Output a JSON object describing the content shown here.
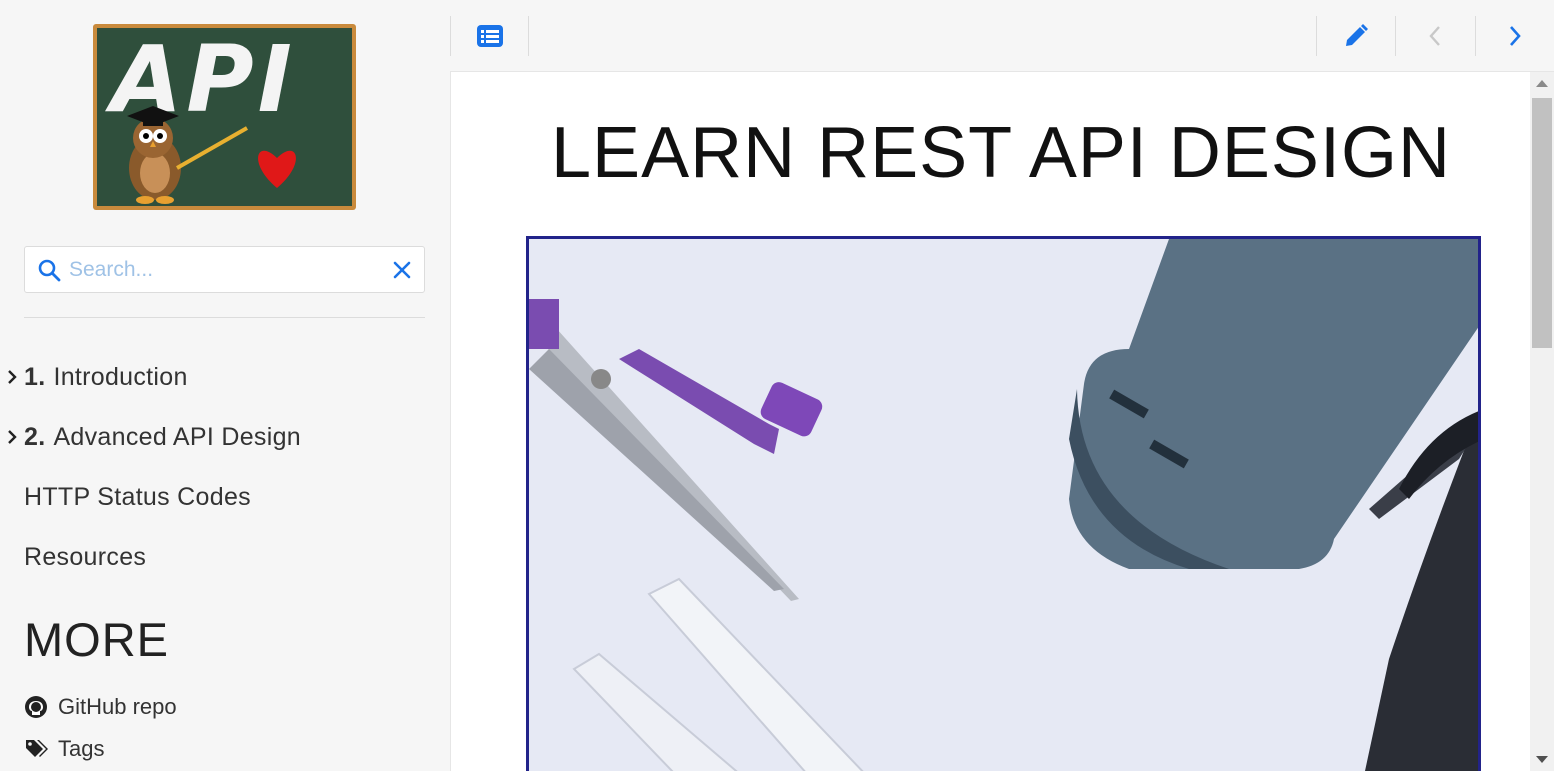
{
  "sidebar": {
    "logo_text": "API",
    "search": {
      "placeholder": "Search...",
      "value": ""
    },
    "nav": [
      {
        "number": "1.",
        "label": "Introduction",
        "expandable": true
      },
      {
        "number": "2.",
        "label": "Advanced API Design",
        "expandable": true
      },
      {
        "number": "",
        "label": "HTTP Status Codes",
        "expandable": false
      },
      {
        "number": "",
        "label": "Resources",
        "expandable": false
      }
    ],
    "more": {
      "heading": "MORE",
      "links": [
        {
          "label": "GitHub repo",
          "icon": "github-icon"
        },
        {
          "label": "Tags",
          "icon": "tags-icon"
        }
      ]
    }
  },
  "topbar": {
    "toc_icon": "list-icon",
    "edit_icon": "pencil-icon",
    "prev_icon": "chevron-left-icon",
    "next_icon": "chevron-right-icon"
  },
  "main": {
    "title": "LEARN REST API DESIGN",
    "hero_alt": "compass, ruler, power bank and pen on a desk"
  },
  "colors": {
    "accent": "#1a73e8",
    "sidebar_bg": "#f6f6f6",
    "hero_border": "#22238a",
    "search_placeholder": "#9fc2e6"
  }
}
